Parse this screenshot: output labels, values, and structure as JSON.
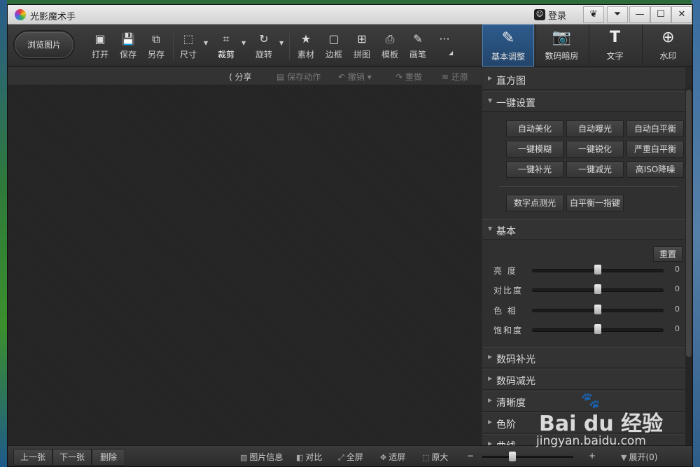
{
  "app": {
    "title": "光影魔术手",
    "login_label": "登录"
  },
  "titlebar_buttons": [
    "❦",
    "⏷",
    "—",
    "☐",
    "✕"
  ],
  "toolbar": {
    "browse_label": "浏览图片",
    "tools": [
      {
        "icon": "▣",
        "label": "打开"
      },
      {
        "icon": "💾",
        "label": "保存"
      },
      {
        "icon": "⧉",
        "label": "另存"
      },
      {
        "icon": "⬚",
        "label": "尺寸"
      },
      {
        "icon": "⌗",
        "label": "裁剪"
      },
      {
        "icon": "↻",
        "label": "旋转"
      },
      {
        "icon": "★",
        "label": "素材"
      },
      {
        "icon": "▢",
        "label": "边框"
      },
      {
        "icon": "⊞",
        "label": "拼图"
      },
      {
        "icon": "⎙",
        "label": "模板"
      },
      {
        "icon": "✎",
        "label": "画笔"
      },
      {
        "icon": "···",
        "label": ""
      }
    ]
  },
  "mode_tabs": [
    {
      "icon": "✎",
      "label": "基本调整"
    },
    {
      "icon": "📷",
      "label": "数码暗房"
    },
    {
      "icon": "T",
      "label": "文字"
    },
    {
      "icon": "⊕",
      "label": "水印"
    }
  ],
  "actions": {
    "share": "分享",
    "save_action": "保存动作",
    "undo": "撤销",
    "redo": "重做",
    "restore": "还原"
  },
  "panel": {
    "histogram": "直方图",
    "one_click": "一键设置",
    "quick_buttons": [
      "自动美化",
      "自动曝光",
      "自动白平衡",
      "一键模糊",
      "一键锐化",
      "严重白平衡",
      "一键补光",
      "一键减光",
      "高ISO降噪"
    ],
    "extra_buttons": [
      "数字点测光",
      "白平衡一指键"
    ],
    "basic": "基本",
    "reset": "重置",
    "sliders": [
      {
        "name": "亮  度",
        "value": "0"
      },
      {
        "name": "对比度",
        "value": "0"
      },
      {
        "name": "色  相",
        "value": "0"
      },
      {
        "name": "饱和度",
        "value": "0"
      }
    ],
    "sections": [
      "数码补光",
      "数码减光",
      "清晰度",
      "色阶",
      "曲线"
    ]
  },
  "statusbar": {
    "prev": "上一张",
    "next": "下一张",
    "delete": "删除",
    "info": "图片信息",
    "compare": "对比",
    "fullscreen": "全屏",
    "fit": "适屏",
    "original": "原大",
    "minus": "−",
    "plus": "+",
    "expand": "展开(0)"
  },
  "watermark": {
    "brand": "Bai du 经验",
    "url": "jingyan.baidu.com"
  }
}
